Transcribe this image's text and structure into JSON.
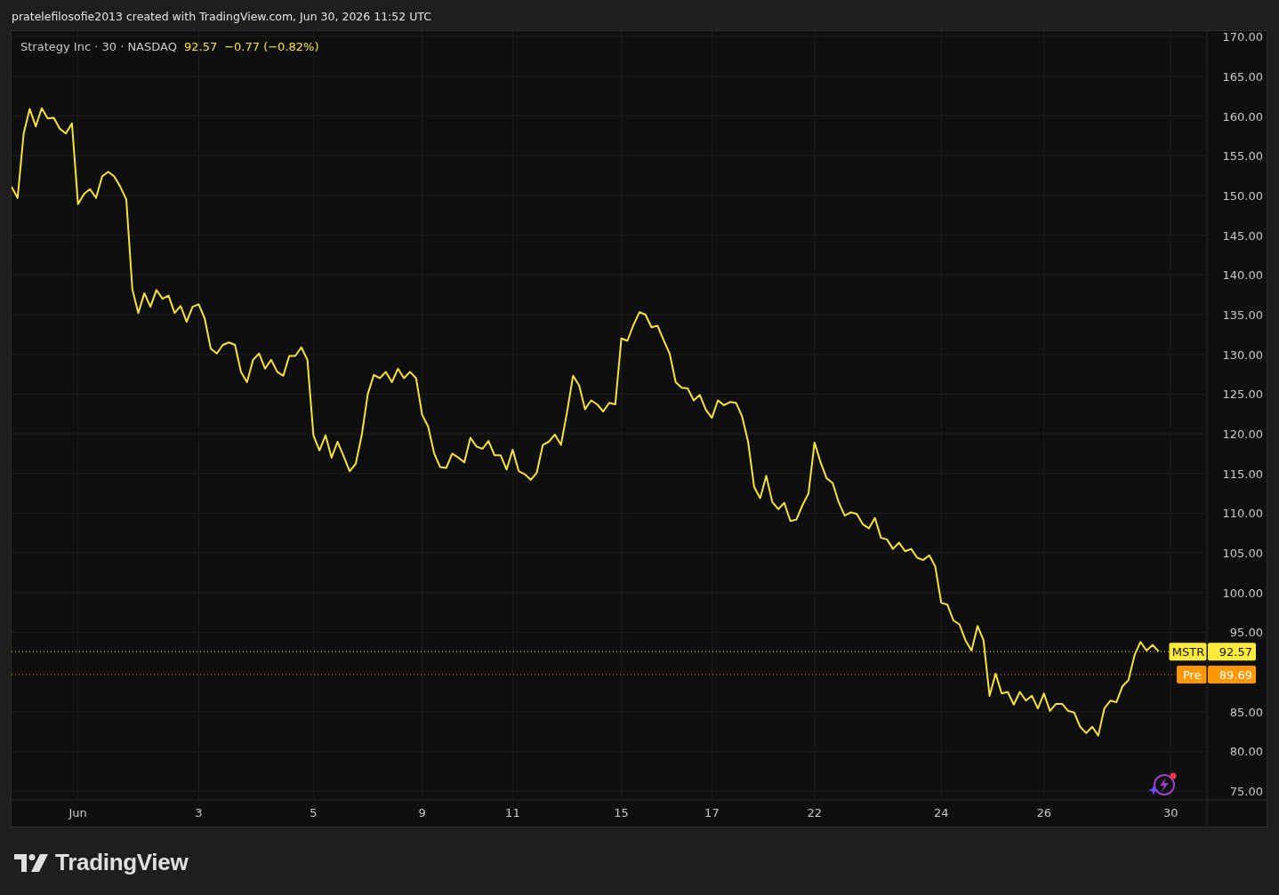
{
  "header": {
    "text": "pratelefilosofie2013 created with TradingView.com, Jun 30, 2026 11:52 UTC"
  },
  "chart": {
    "legend": {
      "symbol": "Strategy Inc · 30 · NASDAQ",
      "price": "92.57",
      "change": "−0.77 (−0.82%)"
    },
    "chart_data": {
      "type": "line",
      "ylim": [
        73.9,
        170.7
      ],
      "categories": [
        null,
        null,
        null,
        null,
        null,
        null,
        null,
        null,
        null,
        null,
        null,
        "Jun",
        null,
        null,
        null,
        null,
        null,
        null,
        null,
        null,
        null,
        null,
        null,
        null,
        null,
        null,
        null,
        null,
        null,
        null,
        null,
        "3",
        null,
        null,
        null,
        null,
        null,
        null,
        null,
        null,
        null,
        null,
        null,
        null,
        null,
        null,
        null,
        null,
        null,
        null,
        "5",
        null,
        null,
        null,
        null,
        null,
        null,
        null,
        null,
        null,
        null,
        null,
        null,
        null,
        null,
        null,
        null,
        null,
        "9",
        null,
        null,
        null,
        null,
        null,
        null,
        null,
        null,
        null,
        null,
        null,
        null,
        null,
        null,
        "11",
        null,
        null,
        null,
        null,
        null,
        null,
        null,
        null,
        null,
        null,
        null,
        null,
        null,
        null,
        null,
        null,
        null,
        "15",
        null,
        null,
        null,
        null,
        null,
        null,
        null,
        null,
        null,
        null,
        null,
        null,
        null,
        null,
        "17",
        null,
        null,
        null,
        null,
        null,
        null,
        null,
        null,
        null,
        null,
        null,
        null,
        null,
        null,
        null,
        null,
        "22",
        null,
        null,
        null,
        null,
        null,
        null,
        null,
        null,
        null,
        null,
        null,
        null,
        null,
        null,
        null,
        null,
        null,
        null,
        null,
        null,
        "24",
        null,
        null,
        null,
        null,
        null,
        null,
        null,
        null,
        null,
        null,
        null,
        null,
        null,
        null,
        null,
        null,
        "26",
        null,
        null,
        null,
        null,
        null,
        null,
        null,
        null,
        null,
        null,
        null,
        null,
        null,
        null,
        null,
        null,
        null,
        null,
        null,
        null,
        "30"
      ],
      "yticks": [
        {
          "value": 75,
          "label": "75.00"
        },
        {
          "value": 80,
          "label": "80.00"
        },
        {
          "value": 85,
          "label": "85.00"
        },
        {
          "value": 95,
          "label": "95.00"
        },
        {
          "value": 100,
          "label": "100.00"
        },
        {
          "value": 105,
          "label": "105.00"
        },
        {
          "value": 110,
          "label": "110.00"
        },
        {
          "value": 115,
          "label": "115.00"
        },
        {
          "value": 120,
          "label": "120.00"
        },
        {
          "value": 125,
          "label": "125.00"
        },
        {
          "value": 130,
          "label": "130.00"
        },
        {
          "value": 135,
          "label": "135.00"
        },
        {
          "value": 140,
          "label": "140.00"
        },
        {
          "value": 145,
          "label": "145.00"
        },
        {
          "value": 150,
          "label": "150.00"
        },
        {
          "value": 155,
          "label": "155.00"
        },
        {
          "value": 160,
          "label": "160.00"
        },
        {
          "value": 165,
          "label": "165.00"
        },
        {
          "value": 170,
          "label": "170.00"
        }
      ],
      "series": [
        {
          "color": "#f7e43a",
          "values": [
            151.1,
            149.7,
            157.8,
            160.9,
            158.7,
            161.0,
            159.7,
            159.8,
            158.4,
            157.8,
            159.1,
            148.9,
            150.2,
            150.8,
            149.7,
            152.4,
            153.0,
            152.4,
            151.1,
            149.5,
            138.2,
            135.2,
            137.7,
            136.0,
            138.1,
            137.0,
            137.4,
            135.2,
            136.1,
            134.1,
            136.0,
            136.3,
            134.5,
            130.7,
            130.1,
            131.2,
            131.5,
            131.2,
            127.8,
            126.5,
            129.3,
            130.1,
            128.2,
            129.3,
            127.8,
            127.3,
            129.8,
            129.8,
            130.9,
            129.3,
            119.8,
            117.9,
            119.8,
            117.0,
            119.0,
            117.2,
            115.3,
            116.2,
            119.8,
            125.0,
            127.4,
            127.0,
            127.8,
            126.5,
            128.2,
            127.0,
            127.8,
            127.0,
            122.4,
            120.9,
            117.5,
            115.8,
            115.7,
            117.5,
            117.0,
            116.4,
            119.5,
            118.4,
            118.1,
            119.1,
            117.3,
            117.3,
            115.5,
            118.0,
            115.3,
            114.9,
            114.2,
            115.1,
            118.6,
            119.0,
            119.9,
            118.6,
            122.7,
            127.3,
            126.1,
            123.1,
            124.2,
            123.7,
            122.8,
            123.9,
            123.7,
            132.0,
            131.7,
            133.7,
            135.3,
            135.0,
            133.4,
            133.6,
            131.8,
            130.1,
            126.5,
            125.8,
            125.7,
            124.2,
            124.9,
            123.0,
            122.0,
            124.2,
            123.6,
            124.0,
            123.9,
            122.2,
            119.0,
            113.3,
            111.9,
            114.7,
            111.4,
            110.5,
            111.3,
            109.0,
            109.2,
            111.0,
            112.5,
            118.9,
            116.4,
            114.4,
            113.8,
            111.4,
            109.7,
            110.1,
            109.9,
            108.6,
            108.1,
            109.4,
            106.9,
            106.7,
            105.5,
            106.3,
            105.2,
            105.5,
            104.4,
            104.1,
            104.7,
            103.3,
            98.7,
            98.5,
            96.5,
            96.0,
            94.0,
            92.7,
            95.8,
            94.0,
            87.0,
            89.8,
            87.3,
            87.5,
            85.9,
            87.5,
            86.4,
            87.0,
            85.4,
            87.3,
            85.1,
            86.0,
            86.0,
            85.1,
            84.9,
            83.1,
            82.3,
            83.1,
            82.0,
            85.4,
            86.4,
            86.2,
            88.2,
            89.0,
            92.1,
            93.8,
            92.7,
            93.4,
            92.6,
            null,
            null
          ]
        }
      ],
      "grid": true,
      "ref_lines": [
        {
          "axis": "y",
          "value": 92.57,
          "label": "92.57",
          "color": "#ffeb3b"
        },
        {
          "axis": "y",
          "value": 89.69,
          "label": "89.69",
          "color": "#ff9800"
        }
      ]
    },
    "price_tags": [
      {
        "tag": "MSTR"
      },
      {
        "tag": "Pre"
      }
    ]
  },
  "footer": {
    "brand": "TradingView"
  }
}
